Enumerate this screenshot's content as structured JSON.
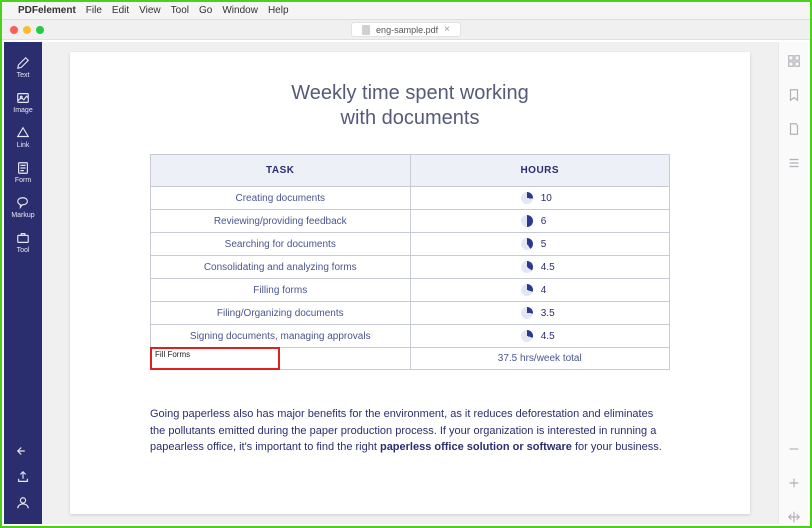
{
  "menubar": {
    "app_name": "PDFelement",
    "items": [
      "File",
      "Edit",
      "View",
      "Tool",
      "Go",
      "Window",
      "Help"
    ]
  },
  "titlebar": {
    "document_name": "eng-sample.pdf"
  },
  "sidebar_left": {
    "items": [
      {
        "label": "Text",
        "icon": "pencil-icon"
      },
      {
        "label": "Image",
        "icon": "image-icon"
      },
      {
        "label": "Link",
        "icon": "link-icon"
      },
      {
        "label": "Form",
        "icon": "form-icon"
      },
      {
        "label": "Markup",
        "icon": "markup-icon"
      },
      {
        "label": "Tool",
        "icon": "tool-icon"
      }
    ],
    "bottom": [
      {
        "icon": "undo-icon"
      },
      {
        "icon": "share-icon"
      },
      {
        "icon": "user-icon"
      }
    ]
  },
  "sidebar_right": {
    "items": [
      {
        "icon": "grid-icon"
      },
      {
        "icon": "bookmark-icon"
      },
      {
        "icon": "page-icon"
      },
      {
        "icon": "lines-icon"
      }
    ],
    "bottom": [
      {
        "icon": "minus-icon"
      },
      {
        "icon": "plus-icon"
      },
      {
        "icon": "arrows-icon"
      }
    ]
  },
  "document": {
    "title_line1": "Weekly time spent working",
    "title_line2": "with documents",
    "table": {
      "headers": [
        "TASK",
        "HOURS"
      ],
      "rows": [
        {
          "task": "Creating documents",
          "hours": "10",
          "pct": 27
        },
        {
          "task": "Reviewing/providing feedback",
          "hours": "6",
          "pct": 50
        },
        {
          "task": "Searching for documents",
          "hours": "5",
          "pct": 40
        },
        {
          "task": "Consolidating and analyzing forms",
          "hours": "4.5",
          "pct": 35
        },
        {
          "task": "Filling forms",
          "hours": "4",
          "pct": 30
        },
        {
          "task": "Filing/Organizing documents",
          "hours": "3.5",
          "pct": 26
        },
        {
          "task": "Signing documents, managing approvals",
          "hours": "4.5",
          "pct": 30
        }
      ],
      "total_row": {
        "highlight_label": "Fill Forms",
        "total": "37.5 hrs/week total"
      }
    },
    "paragraph_pre": "Going paperless also has major benefits for the environment, as it reduces deforestation and eliminates the pollutants emitted during the paper production process. If your organization is interested in running a papearless office, it's important to find the right ",
    "paragraph_bold": "paperless office solution or software",
    "paragraph_post": " for your business."
  },
  "chart_data": {
    "type": "table",
    "title": "Weekly time spent working with documents",
    "columns": [
      "TASK",
      "HOURS"
    ],
    "rows": [
      [
        "Creating documents",
        10
      ],
      [
        "Reviewing/providing feedback",
        6
      ],
      [
        "Searching for documents",
        5
      ],
      [
        "Consolidating and analyzing forms",
        4.5
      ],
      [
        "Filling forms",
        4
      ],
      [
        "Filing/Organizing documents",
        3.5
      ],
      [
        "Signing documents, managing approvals",
        4.5
      ]
    ],
    "total": 37.5,
    "total_label": "37.5 hrs/week total"
  }
}
